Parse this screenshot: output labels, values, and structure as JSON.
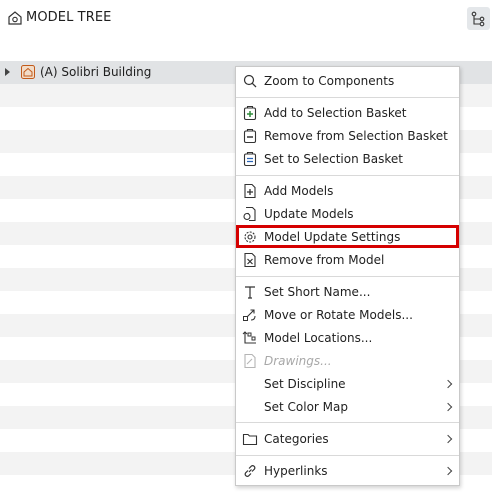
{
  "header": {
    "title": "MODEL TREE",
    "title_icon": "model-tree-icon",
    "action_icon": "hierarchy-icon"
  },
  "tree": {
    "items": [
      {
        "label": "(A) Solibri Building",
        "icon": "building-icon",
        "expanded": false
      }
    ]
  },
  "context_menu": {
    "zoom": "Zoom to Components",
    "add_selection": "Add to Selection Basket",
    "remove_selection": "Remove from Selection Basket",
    "set_selection": "Set to Selection Basket",
    "add_models": "Add Models",
    "update_models": "Update Models",
    "model_update_settings": "Model Update Settings",
    "remove_from_model": "Remove from Model",
    "set_short_name": "Set Short Name...",
    "move_rotate": "Move or Rotate Models...",
    "model_locations": "Model Locations...",
    "drawings": "Drawings...",
    "set_discipline": "Set Discipline",
    "set_color_map": "Set Color Map",
    "categories": "Categories",
    "hyperlinks": "Hyperlinks"
  },
  "colors": {
    "highlight_border": "#d50000",
    "selected_row": "#e1e3e5",
    "alt_row": "#f3f3f3"
  }
}
